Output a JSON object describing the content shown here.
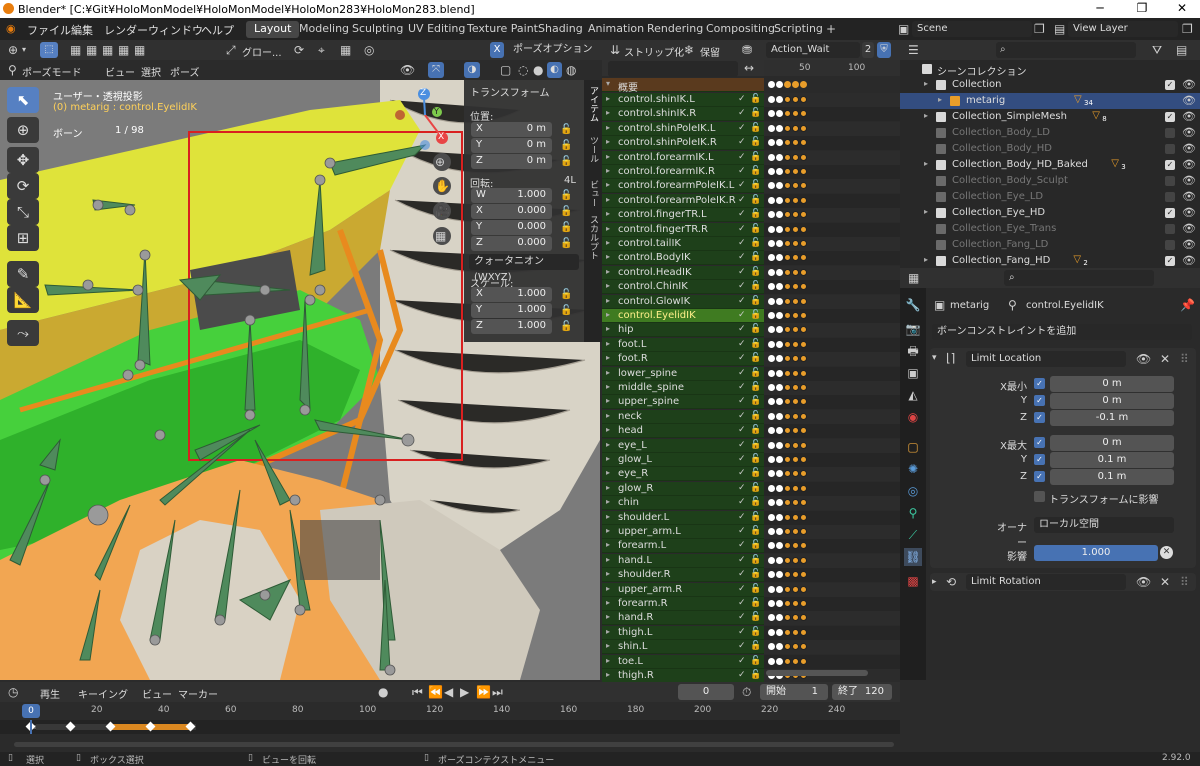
{
  "window": {
    "title": "Blender* [C:¥Git¥HoloMonModel¥HoloMonModel¥HoloMon283¥HoloMon283.blend]"
  },
  "menu": [
    "ファイル",
    "編集",
    "レンダー",
    "ウィンドウ",
    "ヘルプ"
  ],
  "workspaces": [
    "Layout",
    "Modeling",
    "Sculpting",
    "UV Editing",
    "Texture Paint",
    "Shading",
    "Animation",
    "Rendering",
    "Compositing",
    "Scripting"
  ],
  "scene": {
    "scene_name": "Scene",
    "view_layer": "View Layer"
  },
  "viewport_header": {
    "transform_orientation": "グロー...",
    "mode": "ポーズモード",
    "menu": [
      "ビュー",
      "選択",
      "ポーズ"
    ],
    "pose_options": "ポーズオプション",
    "x_mirror": "X"
  },
  "viewport": {
    "view_name": "ユーザー・透視投影",
    "object_info": "(0) metarig : control.EyelidIK",
    "bones_label": "ボーン",
    "bones_count": "1 / 98",
    "gizmo_x": "X",
    "gizmo_y": "Y",
    "gizmo_z": "Z"
  },
  "npanel": {
    "header": "トランスフォーム",
    "location_label": "位置:",
    "location": [
      {
        "axis": "X",
        "value": "0 m"
      },
      {
        "axis": "Y",
        "value": "0 m"
      },
      {
        "axis": "Z",
        "value": "0 m"
      }
    ],
    "rotation_label": "回転:",
    "rotation_mode_short": "4L",
    "rotation": [
      {
        "axis": "W",
        "value": "1.000"
      },
      {
        "axis": "X",
        "value": "0.000"
      },
      {
        "axis": "Y",
        "value": "0.000"
      },
      {
        "axis": "Z",
        "value": "0.000"
      }
    ],
    "rotation_mode": "クォータニオン(WXYZ)",
    "scale_label": "スケール:",
    "scale": [
      {
        "axis": "X",
        "value": "1.000"
      },
      {
        "axis": "Y",
        "value": "1.000"
      },
      {
        "axis": "Z",
        "value": "1.000"
      }
    ],
    "tabs": [
      "アイテム",
      "ツール",
      "ビュー",
      "スカルプト"
    ]
  },
  "dopesheet": {
    "strip_button": "ストリップ化",
    "stash_button": "保留",
    "action_name": "Action_Wait",
    "users_count": "2",
    "ruler": [
      "50",
      "100"
    ],
    "summary": "概要",
    "selected_channel": "control.EyelidIK",
    "channels": [
      "control.shinIK.L",
      "control.shinIK.R",
      "control.shinPoleIK.L",
      "control.shinPoleIK.R",
      "control.forearmIK.L",
      "control.forearmIK.R",
      "control.forearmPoleIK.L",
      "control.forearmPoleIK.R",
      "control.fingerTR.L",
      "control.fingerTR.R",
      "control.tailIK",
      "control.BodyIK",
      "control.HeadIK",
      "control.ChinIK",
      "control.GlowIK",
      "control.EyelidIK",
      "hip",
      "foot.L",
      "foot.R",
      "lower_spine",
      "middle_spine",
      "upper_spine",
      "neck",
      "head",
      "eye_L",
      "glow_L",
      "eye_R",
      "glow_R",
      "chin",
      "shoulder.L",
      "upper_arm.L",
      "forearm.L",
      "hand.L",
      "shoulder.R",
      "upper_arm.R",
      "forearm.R",
      "hand.R",
      "thigh.L",
      "shin.L",
      "toe.L",
      "thigh.R"
    ]
  },
  "outliner": {
    "root": "シーンコレクション",
    "rows": [
      {
        "name": "Collection",
        "level": 1,
        "dim": false,
        "checked": true,
        "badge": ""
      },
      {
        "name": "metarig",
        "level": 2,
        "dim": false,
        "checked": false,
        "selected": true,
        "badge": "34"
      },
      {
        "name": "Collection_SimpleMesh",
        "level": 1,
        "dim": false,
        "checked": true,
        "badge": "8"
      },
      {
        "name": "Collection_Body_LD",
        "level": 1,
        "dim": true,
        "checked": false,
        "badge": ""
      },
      {
        "name": "Collection_Body_HD",
        "level": 1,
        "dim": true,
        "checked": false,
        "badge": ""
      },
      {
        "name": "Collection_Body_HD_Baked",
        "level": 1,
        "dim": false,
        "checked": true,
        "badge": "3"
      },
      {
        "name": "Collection_Body_Sculpt",
        "level": 1,
        "dim": true,
        "checked": false,
        "badge": ""
      },
      {
        "name": "Collection_Eye_LD",
        "level": 1,
        "dim": true,
        "checked": false,
        "badge": ""
      },
      {
        "name": "Collection_Eye_HD",
        "level": 1,
        "dim": false,
        "checked": true,
        "badge": ""
      },
      {
        "name": "Collection_Eye_Trans",
        "level": 1,
        "dim": true,
        "checked": false,
        "badge": ""
      },
      {
        "name": "Collection_Fang_LD",
        "level": 1,
        "dim": true,
        "checked": false,
        "badge": ""
      },
      {
        "name": "Collection_Fang_HD",
        "level": 1,
        "dim": false,
        "checked": true,
        "badge": "2"
      }
    ]
  },
  "properties": {
    "context_object": "metarig",
    "context_bone": "control.EyelidIK",
    "add_constraint": "ボーンコンストレイントを追加",
    "constraint1": {
      "name": "Limit Location",
      "min_x_label": "X最小",
      "min_x": "0 m",
      "min_y_label": "Y",
      "min_y": "0 m",
      "min_z_label": "Z",
      "min_z": "-0.1 m",
      "max_x_label": "X最大",
      "max_x": "0 m",
      "max_y_label": "Y",
      "max_y": "0.1 m",
      "max_z_label": "Z",
      "max_z": "0.1 m",
      "affect_transform": "トランスフォームに影響",
      "owner_label": "オーナー",
      "owner_space": "ローカル空間",
      "influence_label": "影響",
      "influence": "1.000"
    },
    "constraint2": {
      "name": "Limit Rotation"
    }
  },
  "timeline": {
    "menu": [
      "再生",
      "キーイング",
      "ビュー",
      "マーカー"
    ],
    "current_frame": "0",
    "start_label": "開始",
    "start": "1",
    "end_label": "終了",
    "end": "120",
    "current_marker": "0",
    "ruler": [
      "20",
      "40",
      "60",
      "80",
      "100",
      "120",
      "140",
      "160",
      "180",
      "200",
      "220",
      "240"
    ]
  },
  "statusbar": {
    "select": "選択",
    "box_select": "ボックス選択",
    "rotate_view": "ビューを回転",
    "context_menu": "ポーズコンテクストメニュー",
    "version": "2.92.0"
  },
  "colors": {
    "accent": "#4772b3",
    "selected_channel": "#3f7b21",
    "channel_bg": "#1e401a",
    "keyframe": "#e89d2a",
    "bone": "#4f8a5c",
    "selection_box": "#d92020"
  }
}
